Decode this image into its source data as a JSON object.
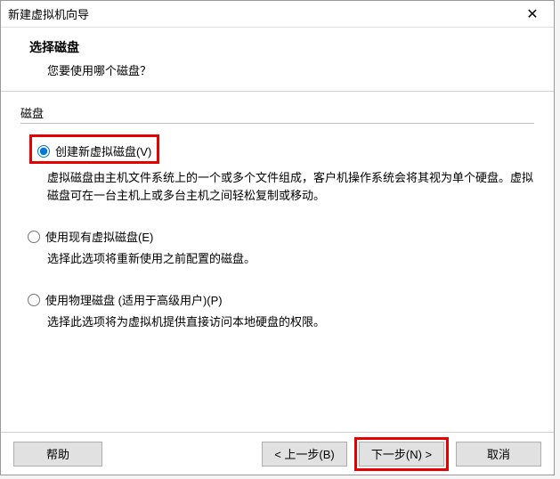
{
  "window": {
    "title": "新建虚拟机向导"
  },
  "header": {
    "title": "选择磁盘",
    "subtitle": "您要使用哪个磁盘？"
  },
  "group": {
    "label": "磁盘"
  },
  "options": {
    "create": {
      "label": "创建新虚拟磁盘(V)",
      "desc": "虚拟磁盘由主机文件系统上的一个或多个文件组成，客户机操作系统会将其视为单个硬盘。虚拟磁盘可在一台主机上或多台主机之间轻松复制或移动。"
    },
    "existing": {
      "label": "使用现有虚拟磁盘(E)",
      "desc": "选择此选项将重新使用之前配置的磁盘。"
    },
    "physical": {
      "label": "使用物理磁盘 (适用于高级用户)(P)",
      "desc": "选择此选项将为虚拟机提供直接访问本地硬盘的权限。"
    }
  },
  "buttons": {
    "help": "帮助",
    "back": "< 上一步(B)",
    "next": "下一步(N) >",
    "cancel": "取消"
  }
}
